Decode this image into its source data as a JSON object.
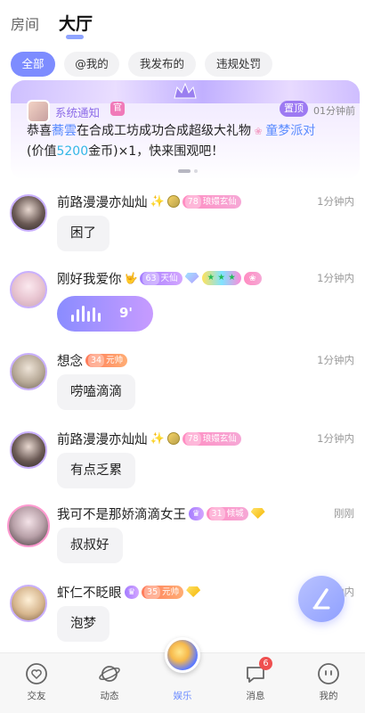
{
  "top_tabs": [
    {
      "label": "房间",
      "active": false
    },
    {
      "label": "大厅",
      "active": true
    }
  ],
  "filters": [
    {
      "label": "全部",
      "active": true
    },
    {
      "label": "@我的",
      "active": false
    },
    {
      "label": "我发布的",
      "active": false
    },
    {
      "label": "违规处罚",
      "active": false
    }
  ],
  "notice": {
    "title": "系统通知",
    "badge": "官",
    "pin_label": "置顶",
    "time": "01分钟前",
    "body_prefix": "恭喜",
    "user1": "蕎雲",
    "body_mid": "在合成工坊成功合成超级大礼物",
    "user2": "童梦派对",
    "body_value_prefix": "(价值",
    "value": "5200",
    "body_value_suffix": "金币)×1，快来围观吧！"
  },
  "messages": [
    {
      "nick": "前路漫漫亦灿灿",
      "time": "1分钟内",
      "type": "text",
      "content": "困了",
      "level_badge": "78",
      "level_title": "琅嬛玄仙"
    },
    {
      "nick": "刚好我爱你",
      "time": "1分钟内",
      "type": "voice",
      "content": "9'",
      "level_badge": "63",
      "level_title": "天仙"
    },
    {
      "nick": "想念",
      "time": "1分钟内",
      "type": "text",
      "content": "唠嗑滴滴",
      "level_badge": "34",
      "level_title": "元帅"
    },
    {
      "nick": "前路漫漫亦灿灿",
      "time": "1分钟内",
      "type": "text",
      "content": "有点乏累",
      "level_badge": "78",
      "level_title": "琅嬛玄仙"
    },
    {
      "nick": "我可不是那娇滴滴女王",
      "time": "刚刚",
      "type": "text",
      "content": "叔叔好",
      "level_badge": "31",
      "level_title": "倾城"
    },
    {
      "nick": "虾仁不眨眼",
      "time": "1分钟内",
      "type": "text",
      "content": "泡梦",
      "level_badge": "35",
      "level_title": "元帅"
    }
  ],
  "bottom_nav": [
    {
      "label": "交友",
      "icon": "heart-circle-icon",
      "active": false
    },
    {
      "label": "动态",
      "icon": "planet-icon",
      "active": false
    },
    {
      "label": "娱乐",
      "icon": "orb-icon",
      "active": true
    },
    {
      "label": "消息",
      "icon": "chat-bubble-icon",
      "active": false,
      "badge": "6"
    },
    {
      "label": "我的",
      "icon": "smiley-icon",
      "active": false
    }
  ],
  "colors": {
    "accent": "#7d8cff",
    "highlight_blue": "#5b8cff",
    "highlight_cyan": "#33b7e6",
    "badge_red": "#ef4f4f"
  }
}
